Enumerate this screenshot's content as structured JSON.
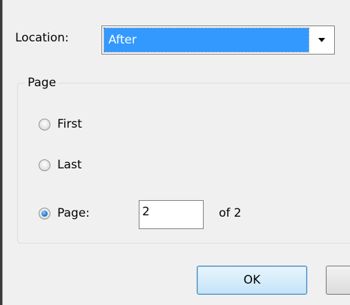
{
  "location": {
    "label": "Location:",
    "selected": "After"
  },
  "page_group": {
    "title": "Page",
    "options": [
      {
        "label": "First",
        "checked": false
      },
      {
        "label": "Last",
        "checked": false
      },
      {
        "label": "Page:",
        "checked": true
      }
    ],
    "page_value": "2",
    "of_text": "of 2"
  },
  "buttons": {
    "ok_label": "OK",
    "cancel_label": ""
  },
  "colors": {
    "selection": "#3399ff",
    "ok_border": "#3c7fb1"
  }
}
